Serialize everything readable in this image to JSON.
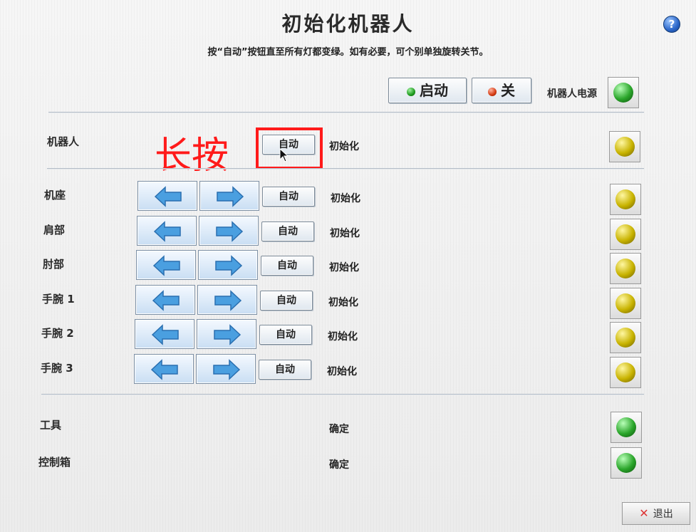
{
  "title": "初始化机器人",
  "subtitle": "按“自动”按钮直至所有灯都变绿。如有必要，可个别单独旋转关节。",
  "help_icon": "?",
  "top": {
    "start_label": "启动",
    "off_label": "关",
    "power_label": "机器人电源",
    "power_light": "green"
  },
  "robot_row": {
    "label": "机器人",
    "auto_label": "自动",
    "status": "初始化",
    "light": "yellow"
  },
  "annotation": "长按",
  "joints": [
    {
      "label": "机座",
      "auto_label": "自动",
      "status": "初始化",
      "light": "yellow"
    },
    {
      "label": "肩部",
      "auto_label": "自动",
      "status": "初始化",
      "light": "yellow"
    },
    {
      "label": "肘部",
      "auto_label": "自动",
      "status": "初始化",
      "light": "yellow"
    },
    {
      "label": "手腕 1",
      "auto_label": "自动",
      "status": "初始化",
      "light": "yellow"
    },
    {
      "label": "手腕 2",
      "auto_label": "自动",
      "status": "初始化",
      "light": "yellow"
    },
    {
      "label": "手腕 3",
      "auto_label": "自动",
      "status": "初始化",
      "light": "yellow"
    }
  ],
  "tool_row": {
    "label": "工具",
    "status": "确定",
    "light": "green"
  },
  "controller_row": {
    "label": "控制箱",
    "status": "确定",
    "light": "green"
  },
  "exit_label": "退出",
  "colors": {
    "annotation_red": "#ff1a1a",
    "light_yellow": "#c8b300",
    "light_green": "#2aa52a",
    "arrow_blue": "#4a9fe0"
  }
}
